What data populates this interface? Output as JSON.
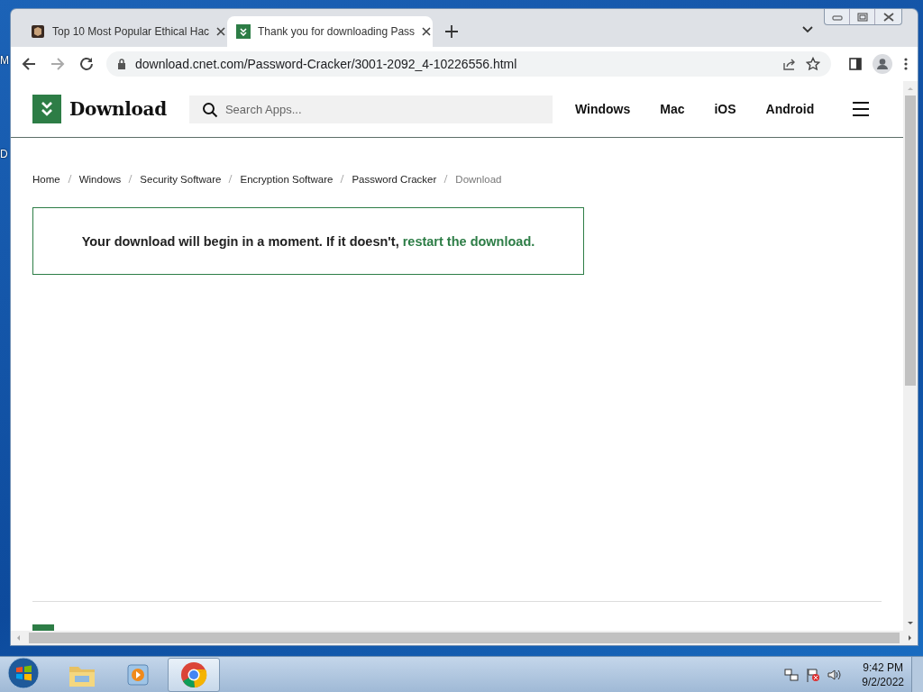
{
  "desktop": {
    "icon_labels": [
      "M",
      "D"
    ]
  },
  "browser": {
    "tabs": [
      {
        "title": "Top 10 Most Popular Ethical Hac",
        "selected": false
      },
      {
        "title": "Thank you for downloading Pass",
        "selected": true
      }
    ],
    "address": "download.cnet.com/Password-Cracker/3001-2092_4-10226556.html"
  },
  "site": {
    "logo": "Download",
    "search": {
      "placeholder": "Search Apps..."
    },
    "nav": [
      "Windows",
      "Mac",
      "iOS",
      "Android"
    ],
    "breadcrumb": [
      {
        "label": "Home",
        "current": false
      },
      {
        "label": "Windows",
        "current": false
      },
      {
        "label": "Security Software",
        "current": false
      },
      {
        "label": "Encryption Software",
        "current": false
      },
      {
        "label": "Password Cracker",
        "current": false
      },
      {
        "label": "Download",
        "current": true
      }
    ],
    "notice": {
      "text": "Your download will begin in a moment. If it doesn't,",
      "link": "restart the download."
    }
  },
  "taskbar": {
    "apps": [
      {
        "kind": "folder",
        "selected": false
      },
      {
        "kind": "media",
        "selected": false
      },
      {
        "kind": "chrome",
        "selected": true
      }
    ],
    "time": "9:42 PM",
    "date": "9/2/2022"
  }
}
